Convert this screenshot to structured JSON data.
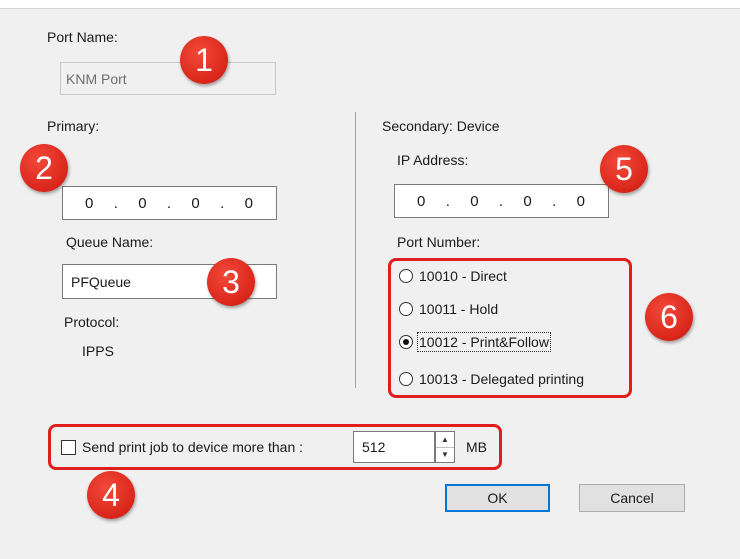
{
  "port_name": {
    "label": "Port Name:",
    "value": "KNM Port"
  },
  "primary": {
    "label": "Primary:",
    "ip_octets": [
      "0",
      "0",
      "0",
      "0"
    ],
    "queue_name_label": "Queue Name:",
    "queue_name_value": "PFQueue",
    "protocol_label": "Protocol:",
    "protocol_value": "IPPS"
  },
  "secondary": {
    "label": "Secondary: Device",
    "ip_label": "IP Address:",
    "ip_octets": [
      "0",
      "0",
      "0",
      "0"
    ],
    "port_number_label": "Port Number:",
    "port_options": [
      {
        "label": "10010 - Direct",
        "selected": false
      },
      {
        "label": "10011 - Hold",
        "selected": false
      },
      {
        "label": "10012 - Print&Follow",
        "selected": true
      },
      {
        "label": "10013 - Delegated printing",
        "selected": false
      }
    ]
  },
  "send_job": {
    "label": "Send print job to device more than :",
    "value": "512",
    "unit": "MB",
    "checked": false
  },
  "buttons": {
    "ok": "OK",
    "cancel": "Cancel"
  },
  "callouts": [
    "1",
    "2",
    "3",
    "4",
    "5",
    "6"
  ],
  "colors": {
    "callout": "#d9261a",
    "highlight": "#e01e1e",
    "default_button_border": "#0078d7"
  }
}
